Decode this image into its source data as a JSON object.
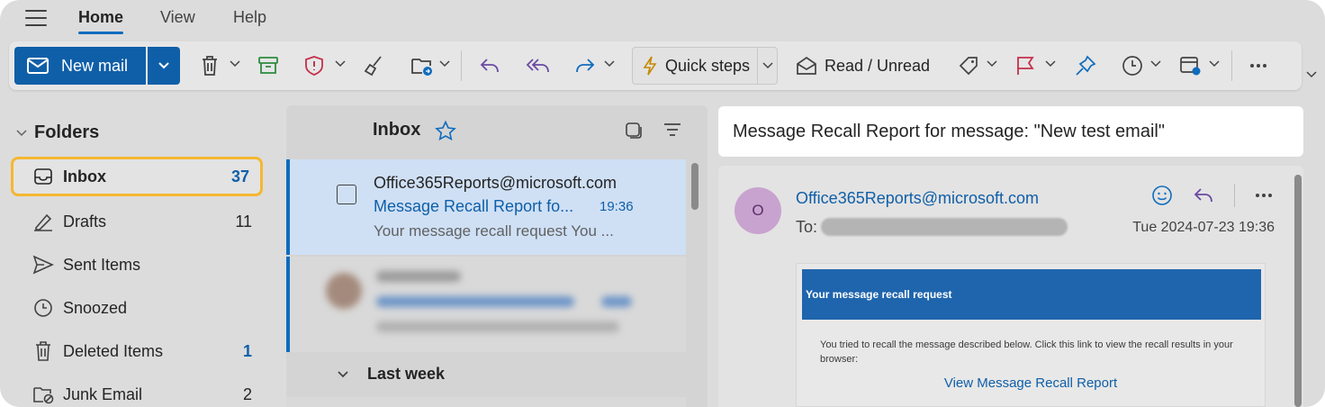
{
  "menu": {
    "tabs": [
      {
        "label": "Home",
        "active": true
      },
      {
        "label": "View",
        "active": false
      },
      {
        "label": "Help",
        "active": false
      }
    ]
  },
  "toolbar": {
    "new_mail": "New mail",
    "quick_steps": "Quick steps",
    "read_unread": "Read / Unread",
    "icons": [
      "delete-icon",
      "archive-icon",
      "report-icon",
      "sweep-icon",
      "move-icon",
      "reply-icon",
      "reply-all-icon",
      "forward-icon",
      "quick-steps-icon",
      "read-unread-icon",
      "tag-icon",
      "flag-icon",
      "pin-icon",
      "snooze-icon",
      "rules-icon",
      "more-icon"
    ],
    "colors": {
      "primary": "#0f5fa8",
      "archive": "#2e8b3e",
      "report": "#c4314b",
      "flag": "#c4314b",
      "reply": "#6b4aa3",
      "forward": "#0f6cbd"
    }
  },
  "sidebar": {
    "title": "Folders",
    "items": [
      {
        "label": "Inbox",
        "count": "37",
        "selected": true,
        "icon": "inbox-icon"
      },
      {
        "label": "Drafts",
        "count": "11",
        "selected": false,
        "icon": "drafts-icon"
      },
      {
        "label": "Sent Items",
        "count": "",
        "selected": false,
        "icon": "sent-icon"
      },
      {
        "label": "Snoozed",
        "count": "",
        "selected": false,
        "icon": "snooze-icon"
      },
      {
        "label": "Deleted Items",
        "count": "1",
        "selected": false,
        "icon": "trash-icon"
      },
      {
        "label": "Junk Email",
        "count": "2",
        "selected": false,
        "icon": "junk-icon"
      }
    ]
  },
  "list": {
    "title": "Inbox",
    "selected_message": {
      "sender": "Office365Reports@microsoft.com",
      "subject": "Message Recall Report fo...",
      "time": "19:36",
      "preview": "Your message recall request You ..."
    },
    "group_label": "Last week"
  },
  "reading": {
    "subject": "Message Recall Report for message: \"New test email\"",
    "avatar_initial": "O",
    "from": "Office365Reports@microsoft.com",
    "to_label": "To:",
    "date": "Tue 2024-07-23 19:36",
    "email": {
      "banner": "Your message recall request",
      "body": "You tried to recall the message described below. Click this link to view the recall results in your browser:",
      "link": "View Message Recall Report"
    }
  }
}
